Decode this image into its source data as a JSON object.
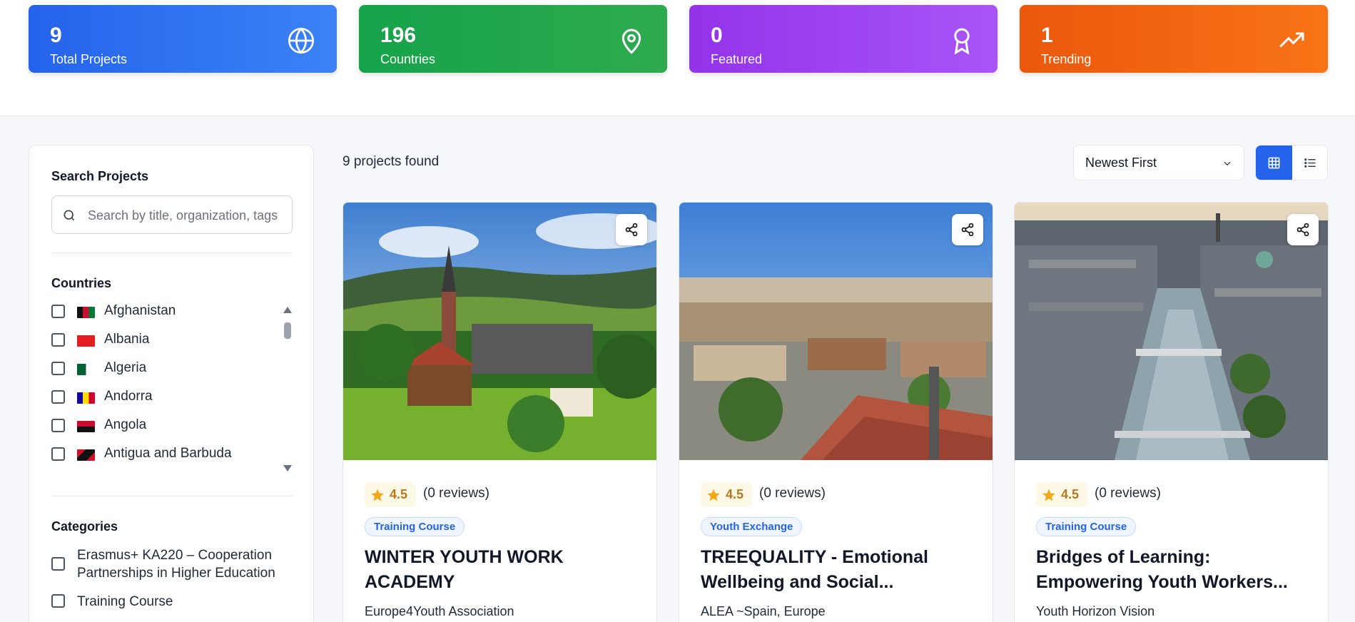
{
  "stats": [
    {
      "value": "9",
      "label": "Total Projects",
      "icon": "globe-icon"
    },
    {
      "value": "196",
      "label": "Countries",
      "icon": "map-pin-icon"
    },
    {
      "value": "0",
      "label": "Featured",
      "icon": "award-icon"
    },
    {
      "value": "1",
      "label": "Trending",
      "icon": "trending-up-icon"
    }
  ],
  "sidebar": {
    "search_title": "Search Projects",
    "search_placeholder": "Search by title, organization, tags",
    "countries_title": "Countries",
    "countries": [
      "Afghanistan",
      "Albania",
      "Algeria",
      "Andorra",
      "Angola",
      "Antigua and Barbuda"
    ],
    "categories_title": "Categories",
    "categories": [
      "Erasmus+ KA220 – Cooperation Partnerships in Higher Education",
      "Training Course"
    ]
  },
  "toolbar": {
    "results_count": "9 projects found",
    "sort_value": "Newest First"
  },
  "projects": [
    {
      "rating": "4.5",
      "reviews": "(0 reviews)",
      "category": "Training Course",
      "title": "WINTER YOUTH WORK ACADEMY",
      "organization": "Europe4Youth Association"
    },
    {
      "rating": "4.5",
      "reviews": "(0 reviews)",
      "category": "Youth Exchange",
      "title": "TREEQUALITY - Emotional Wellbeing and Social...",
      "organization": "ALEA ~Spain, Europe"
    },
    {
      "rating": "4.5",
      "reviews": "(0 reviews)",
      "category": "Training Course",
      "title": "Bridges of Learning: Empowering Youth Workers...",
      "organization": "Youth Horizon Vision"
    }
  ],
  "colors": {
    "primary": "#2563eb",
    "stat_blue": "#2563eb",
    "stat_green": "#16a34a",
    "stat_purple": "#9333ea",
    "stat_orange": "#ea580c",
    "rating_star": "#f2a818"
  }
}
